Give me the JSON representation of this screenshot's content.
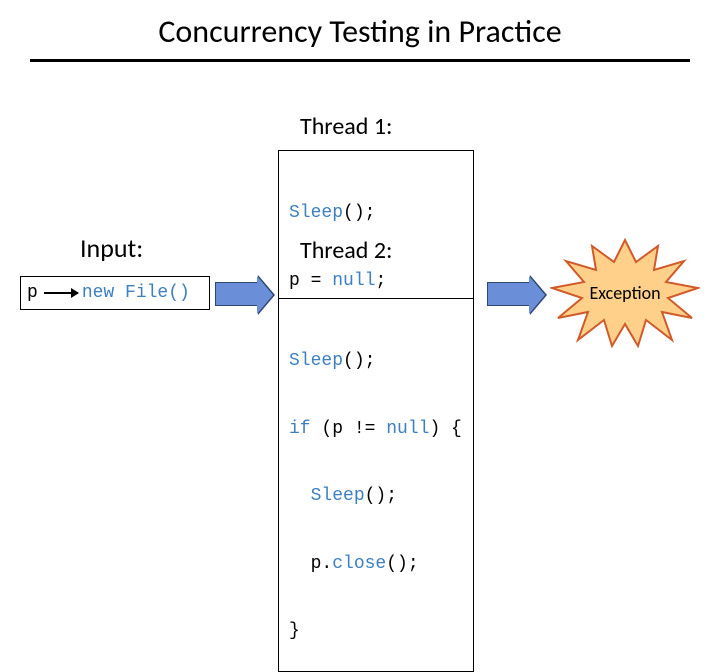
{
  "title": "Concurrency Testing in Practice",
  "input": {
    "heading": "Input:",
    "var": "p",
    "expr_new": "new",
    "expr_call": "File()"
  },
  "thread1": {
    "heading": "Thread 1:",
    "code": {
      "l1_call": "Sleep",
      "l1_rest": "();",
      "l2_lhs": "p = ",
      "l2_null": "null",
      "l2_semi": ";"
    }
  },
  "thread2": {
    "heading": "Thread 2:",
    "code": {
      "l1_call": "Sleep",
      "l1_rest": "();",
      "l2_if": "if",
      "l2_open": " (p != ",
      "l2_null": "null",
      "l2_close": ") {",
      "l3_indent": "  ",
      "l3_call": "Sleep",
      "l3_rest": "();",
      "l4_indent": "  p.",
      "l4_call": "close",
      "l4_rest": "(); ",
      "l5": "}"
    }
  },
  "result": {
    "label": "Exception"
  },
  "colors": {
    "arrow_fill": "#6a8fd8",
    "arrow_stroke": "#2f486e",
    "burst_fill": "#ffd08a",
    "burst_stroke": "#d05a2a"
  }
}
